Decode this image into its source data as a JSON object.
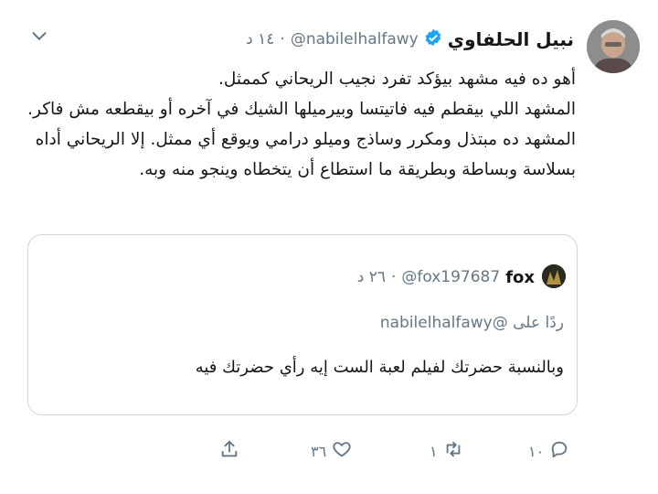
{
  "tweet": {
    "author_name": "نبيل الحلفاوي",
    "handle": "@nabilelhalfawy",
    "separator": "·",
    "time": "١٤ د",
    "lines": [
      "أهو ده فيه مشهد بيؤكد تفرد نجيب الريحاني كممثل.",
      "المشهد اللي بيقطم فيه فاتيتسا وبيرميلها الشيك في آخره أو بيقطعه مش فاكر.",
      "المشهد ده مبتذل ومكرر وساذج وميلو درامي ويوقع أي ممثل. إلا الريحاني أداه",
      "بسلاسة وبساطة وبطريقة ما استطاع أن يتخطاه وينجو منه وبه."
    ]
  },
  "quoted": {
    "author_name": "fox",
    "handle": "@fox197687",
    "separator": "·",
    "time": "٢٦ د",
    "reply_prefix": "ردًا على",
    "reply_handle": "@nabilelhalfawy",
    "text": "وبالنسبة حضرتك لفيلم لعبة الست إيه رأي حضرتك فيه"
  },
  "actions": {
    "reply_count": "١٠",
    "retweet_count": "١",
    "like_count": "٣٦"
  },
  "icons": {
    "verified": "verified-badge-icon",
    "menu": "chevron-down-icon",
    "reply": "reply-icon",
    "retweet": "retweet-icon",
    "like": "heart-icon",
    "share": "share-icon"
  },
  "colors": {
    "verified_blue": "#1da1f2",
    "muted": "#657786",
    "border": "#ccd6dd"
  }
}
